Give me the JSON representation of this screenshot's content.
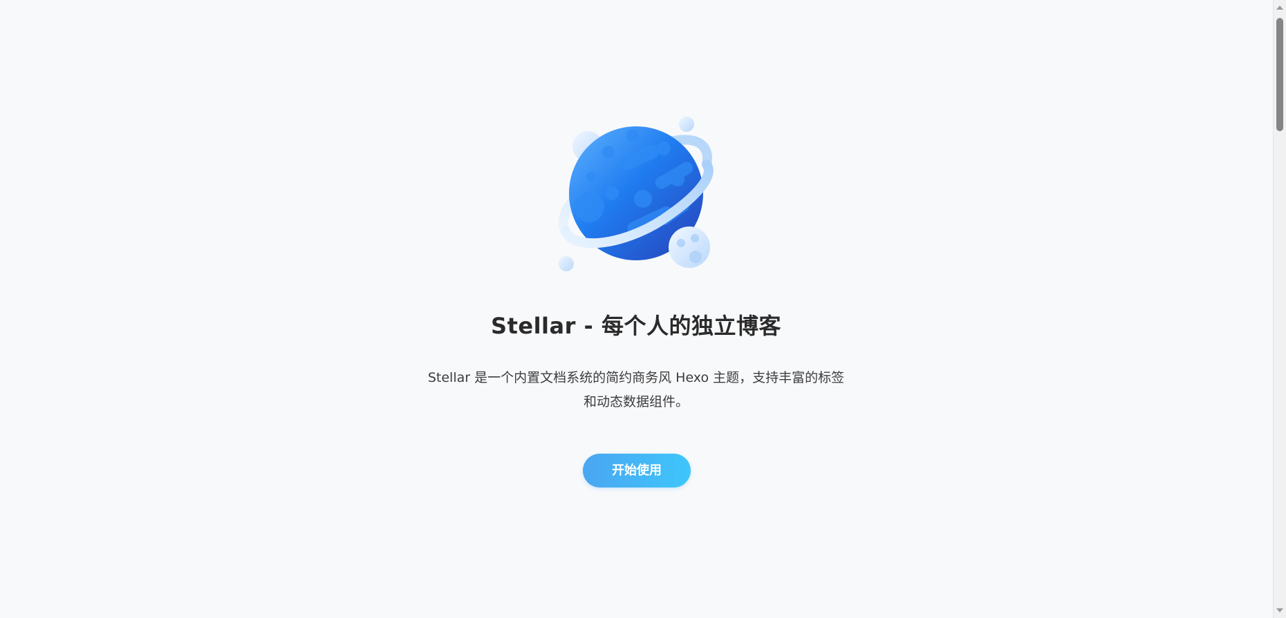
{
  "hero": {
    "title": "Stellar - 每个人的独立博客",
    "description": "Stellar 是一个内置文档系统的简约商务风 Hexo 主题，支持丰富的标签和动态数据组件。",
    "button_label": "开始使用",
    "illustration_icon": "planet-icon"
  },
  "colors": {
    "background": "#f8f9fb",
    "title_text": "#2b2b2b",
    "body_text": "#3c3c3c",
    "button_gradient_start": "#4aa6f2",
    "button_gradient_end": "#3ec6fb",
    "planet_blue": "#1f7cf0",
    "ring_light": "#c6e0fb"
  }
}
